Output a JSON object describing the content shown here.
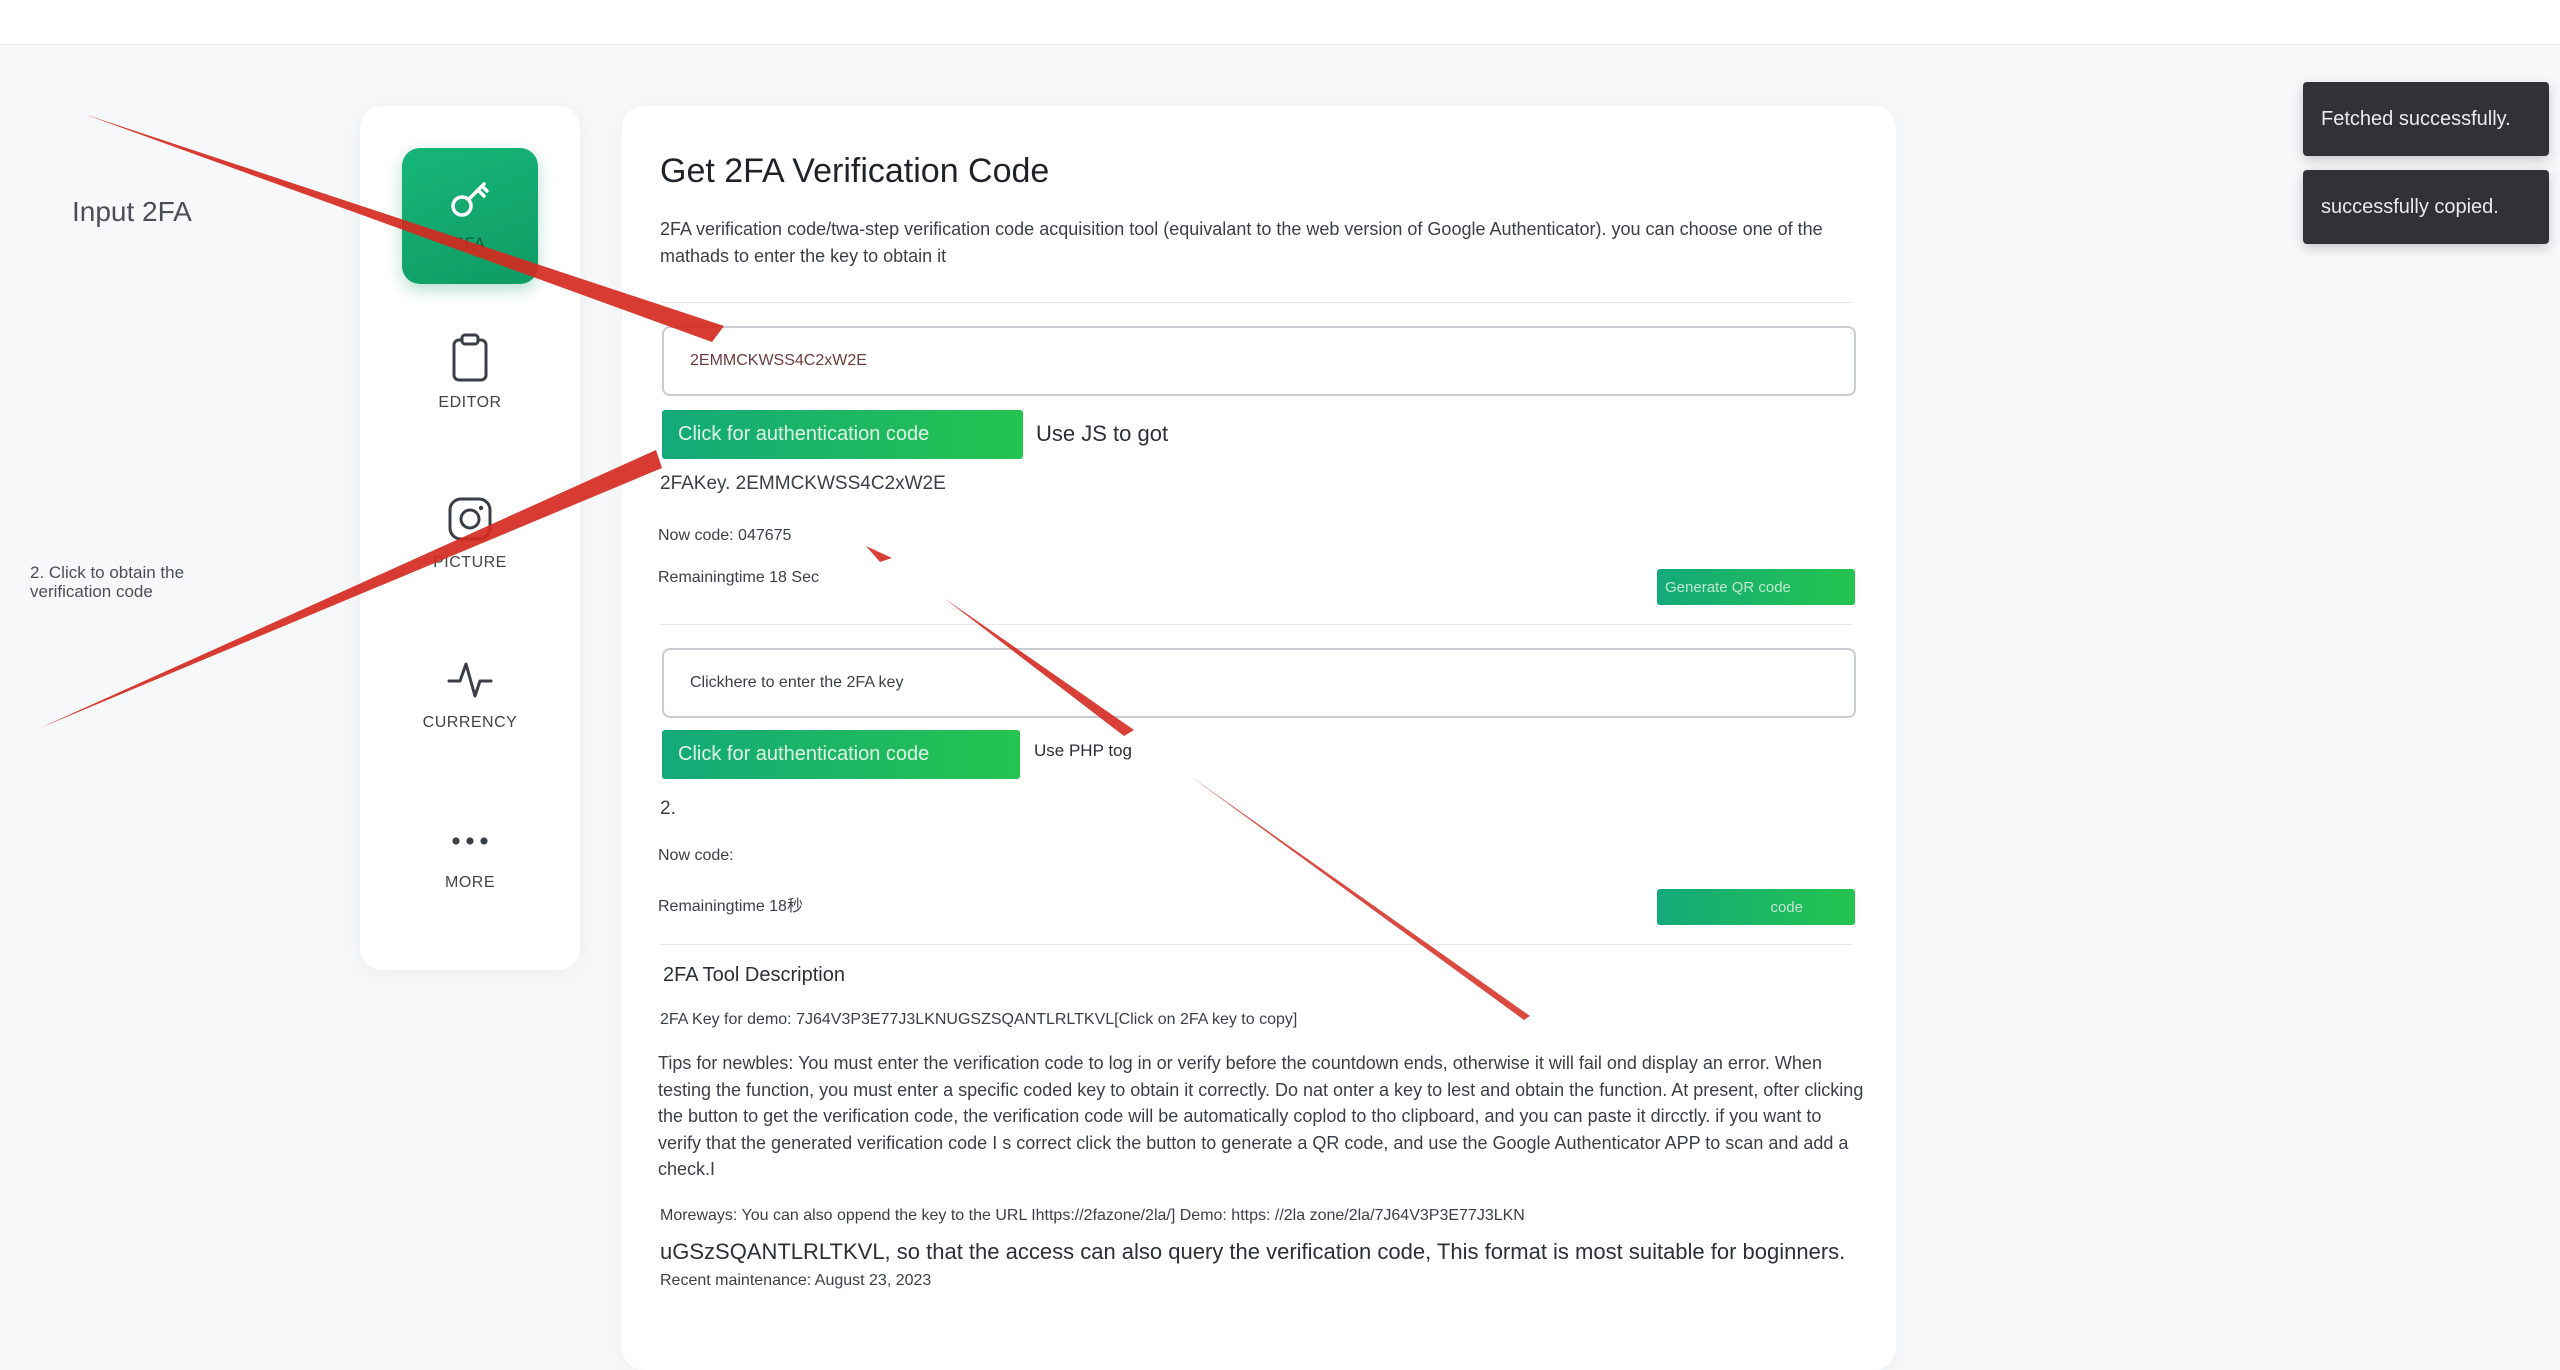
{
  "annotations": {
    "input_2fa": "Input 2FA",
    "click_to_obtain": "2. Click to obtain the verification code"
  },
  "sidebar": {
    "items": [
      {
        "label": "2FA",
        "icon": "key-icon"
      },
      {
        "label": "EDITOR",
        "icon": "clipboard-icon"
      },
      {
        "label": "PICTURE",
        "icon": "instagram-icon"
      },
      {
        "label": "CURRENCY",
        "icon": "pulse-icon"
      },
      {
        "label": "MORE",
        "icon": "more-icon"
      }
    ]
  },
  "main": {
    "title": "Get 2FA Verification Code",
    "subtitle": "2FA verification code/twa-step verification code acquisition tool (equivalant to the web version of Google Authenticator). you can choose one of the mathads to enter the key to obtain it",
    "js_section": {
      "key_value": "2EMMCKWSS4C2xW2E",
      "button_label": "Click for authentication code",
      "method_label": "Use JS to got",
      "key_line": "2FAKey. 2EMMCKWSS4C2xW2E",
      "now_code": "Now code: 047675",
      "remaining": "Remainingtime 18 Sec",
      "qr_button": "Generate QR code"
    },
    "php_section": {
      "placeholder": "Clickhere to enter the 2FA key",
      "button_label": "Click for authentication code",
      "method_label": "Use PHP tog",
      "key_line": "2.",
      "now_code": "Now code:",
      "remaining": "Remainingtime 18秒",
      "qr_button": "code"
    },
    "description": {
      "title": "2FA Tool Description",
      "demo_key": "2FA Key for demo: 7J64V3P3E77J3LKNUGSZSQANTLRLTKVL[Click on 2FA key to copy]",
      "tips": "Tips for newbles: You must enter the verification code to log in or verify before the countdown ends, otherwise it will fail ond display an error. When testing the function, you must enter a specific coded key to obtain it correctly. Do nat onter a key to lest and obtain the function. At present, ofter clicking the button to get the verification code, the verification code will be automatically coplod to tho clipboard, and you can paste it dircctly. if you want to verify that the generated verification code I s correct click the button to generate a QR code, and use the Google Authenticator APP to scan and add a check.I",
      "more_ways": "Moreways: You can also oppend the key to the URL Ihttps://2fazone/2la/] Demo: https: //2la zone/2la/7J64V3P3E77J3LKN",
      "more_ways_cont": "uGSzSQANTLRLTKVL, so that the access can also query the verification code, This format is most suitable for boginners.",
      "maintenance": "Recent maintenance: August 23, 2023"
    }
  },
  "toasts": {
    "fetched": "Fetched successfully.",
    "copied": "successfully copied."
  },
  "colors": {
    "accent_green": "#14a97a",
    "arrow_red": "#d42a20",
    "toast_bg": "#303236"
  }
}
